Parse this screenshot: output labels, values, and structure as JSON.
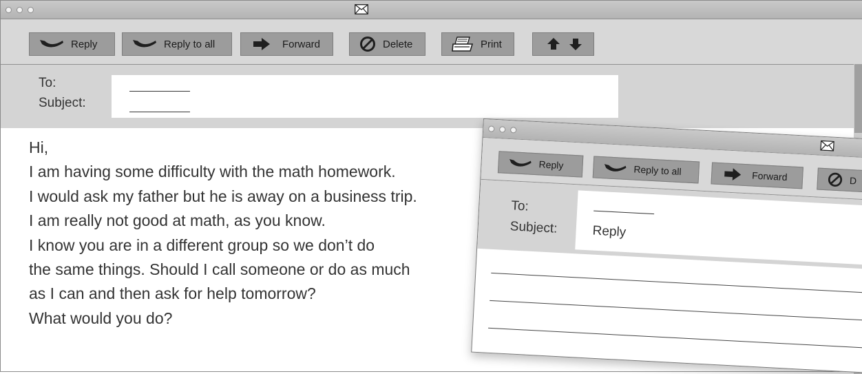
{
  "main_window": {
    "toolbar": {
      "reply": "Reply",
      "reply_all": "Reply to all",
      "forward": "Forward",
      "delete": "Delete",
      "print": "Print"
    },
    "header": {
      "to_label": "To:",
      "subject_label": "Subject:"
    },
    "body_lines": [
      "Hi,",
      "I am having some difficulty with the math homework.",
      "I would ask my father but he is away on a business trip.",
      "I am really not good at math, as you know.",
      "I know you are in a different group so we don’t do",
      "the same things. Should I call someone or do as much",
      "as I can and then ask for help tomorrow?",
      "What would you do?"
    ]
  },
  "reply_window": {
    "toolbar": {
      "reply": "Reply",
      "reply_all": "Reply to all",
      "forward": "Forward",
      "delete_partial": "D"
    },
    "header": {
      "to_label": "To:",
      "subject_label": "Subject:",
      "subject_value": "Reply"
    }
  },
  "colors": {
    "titlebar": "#bdbdbd",
    "toolbar": "#d8d8d8",
    "button": "#9c9c9c",
    "header": "#d4d4d4",
    "icon": "#1f1f1f"
  },
  "icons": [
    "envelope-icon",
    "reply-icon",
    "reply-all-icon",
    "forward-arrow-icon",
    "delete-icon",
    "print-icon",
    "up-arrow-icon",
    "down-arrow-icon"
  ]
}
